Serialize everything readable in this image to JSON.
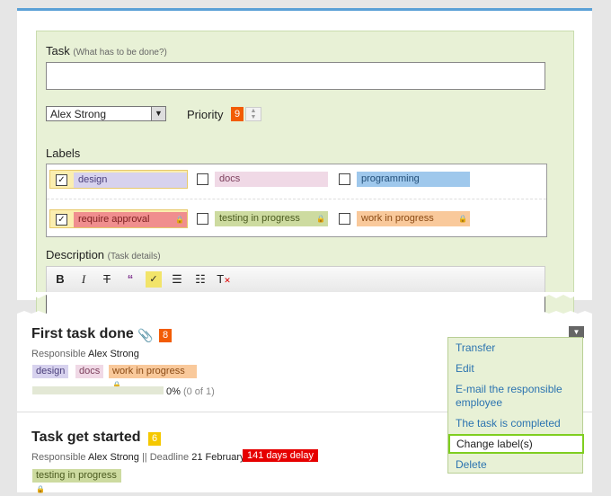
{
  "form": {
    "task_label": "Task",
    "task_hint": "(What has to be done?)",
    "task_value": "",
    "responsible": "Alex Strong",
    "priority_label": "Priority",
    "priority_value": "9",
    "labels_label": "Labels",
    "labels": [
      {
        "name": "design",
        "checked": true,
        "color": "#d7d2ee",
        "locked": false
      },
      {
        "name": "docs",
        "checked": false,
        "color": "#f0d9e6",
        "locked": false
      },
      {
        "name": "programming",
        "checked": false,
        "color": "#9fc8ec",
        "locked": false
      },
      {
        "name": "require approval",
        "checked": true,
        "color": "#f08e8e",
        "locked": true
      },
      {
        "name": "testing in progress",
        "checked": false,
        "color": "#cddba0",
        "locked": true
      },
      {
        "name": "work in progress",
        "checked": false,
        "color": "#f9c99b",
        "locked": true
      }
    ],
    "description_label": "Description",
    "description_hint": "(Task details)",
    "toolbar": [
      "bold-icon",
      "italic-icon",
      "strikethrough-icon",
      "quote-icon",
      "spellcheck-icon",
      "bulleted-list-icon",
      "numbered-list-icon",
      "remove-format-icon"
    ]
  },
  "tasks": [
    {
      "title": "First task done",
      "priority": "8",
      "priority_color": "#f25c05",
      "responsible_label": "Responsible",
      "responsible": "Alex Strong",
      "tags": [
        "design",
        "docs",
        "work in progress"
      ],
      "progress_fraction": 0,
      "progress_text": "0%",
      "progress_detail": "(0 of 1)"
    },
    {
      "title": "Task get started",
      "priority": "6",
      "priority_color": "#f5c800",
      "responsible_label": "Responsible",
      "responsible": "Alex Strong",
      "deadline_label": "|| Deadline",
      "deadline": "21 February",
      "delay": "141 days delay",
      "tags": [
        "testing in progress"
      ]
    }
  ],
  "menu": {
    "items": [
      "Transfer",
      "Edit",
      "E-mail the responsible employee",
      "The task is completed",
      "Change label(s)",
      "Delete"
    ],
    "highlighted": "Change label(s)"
  }
}
